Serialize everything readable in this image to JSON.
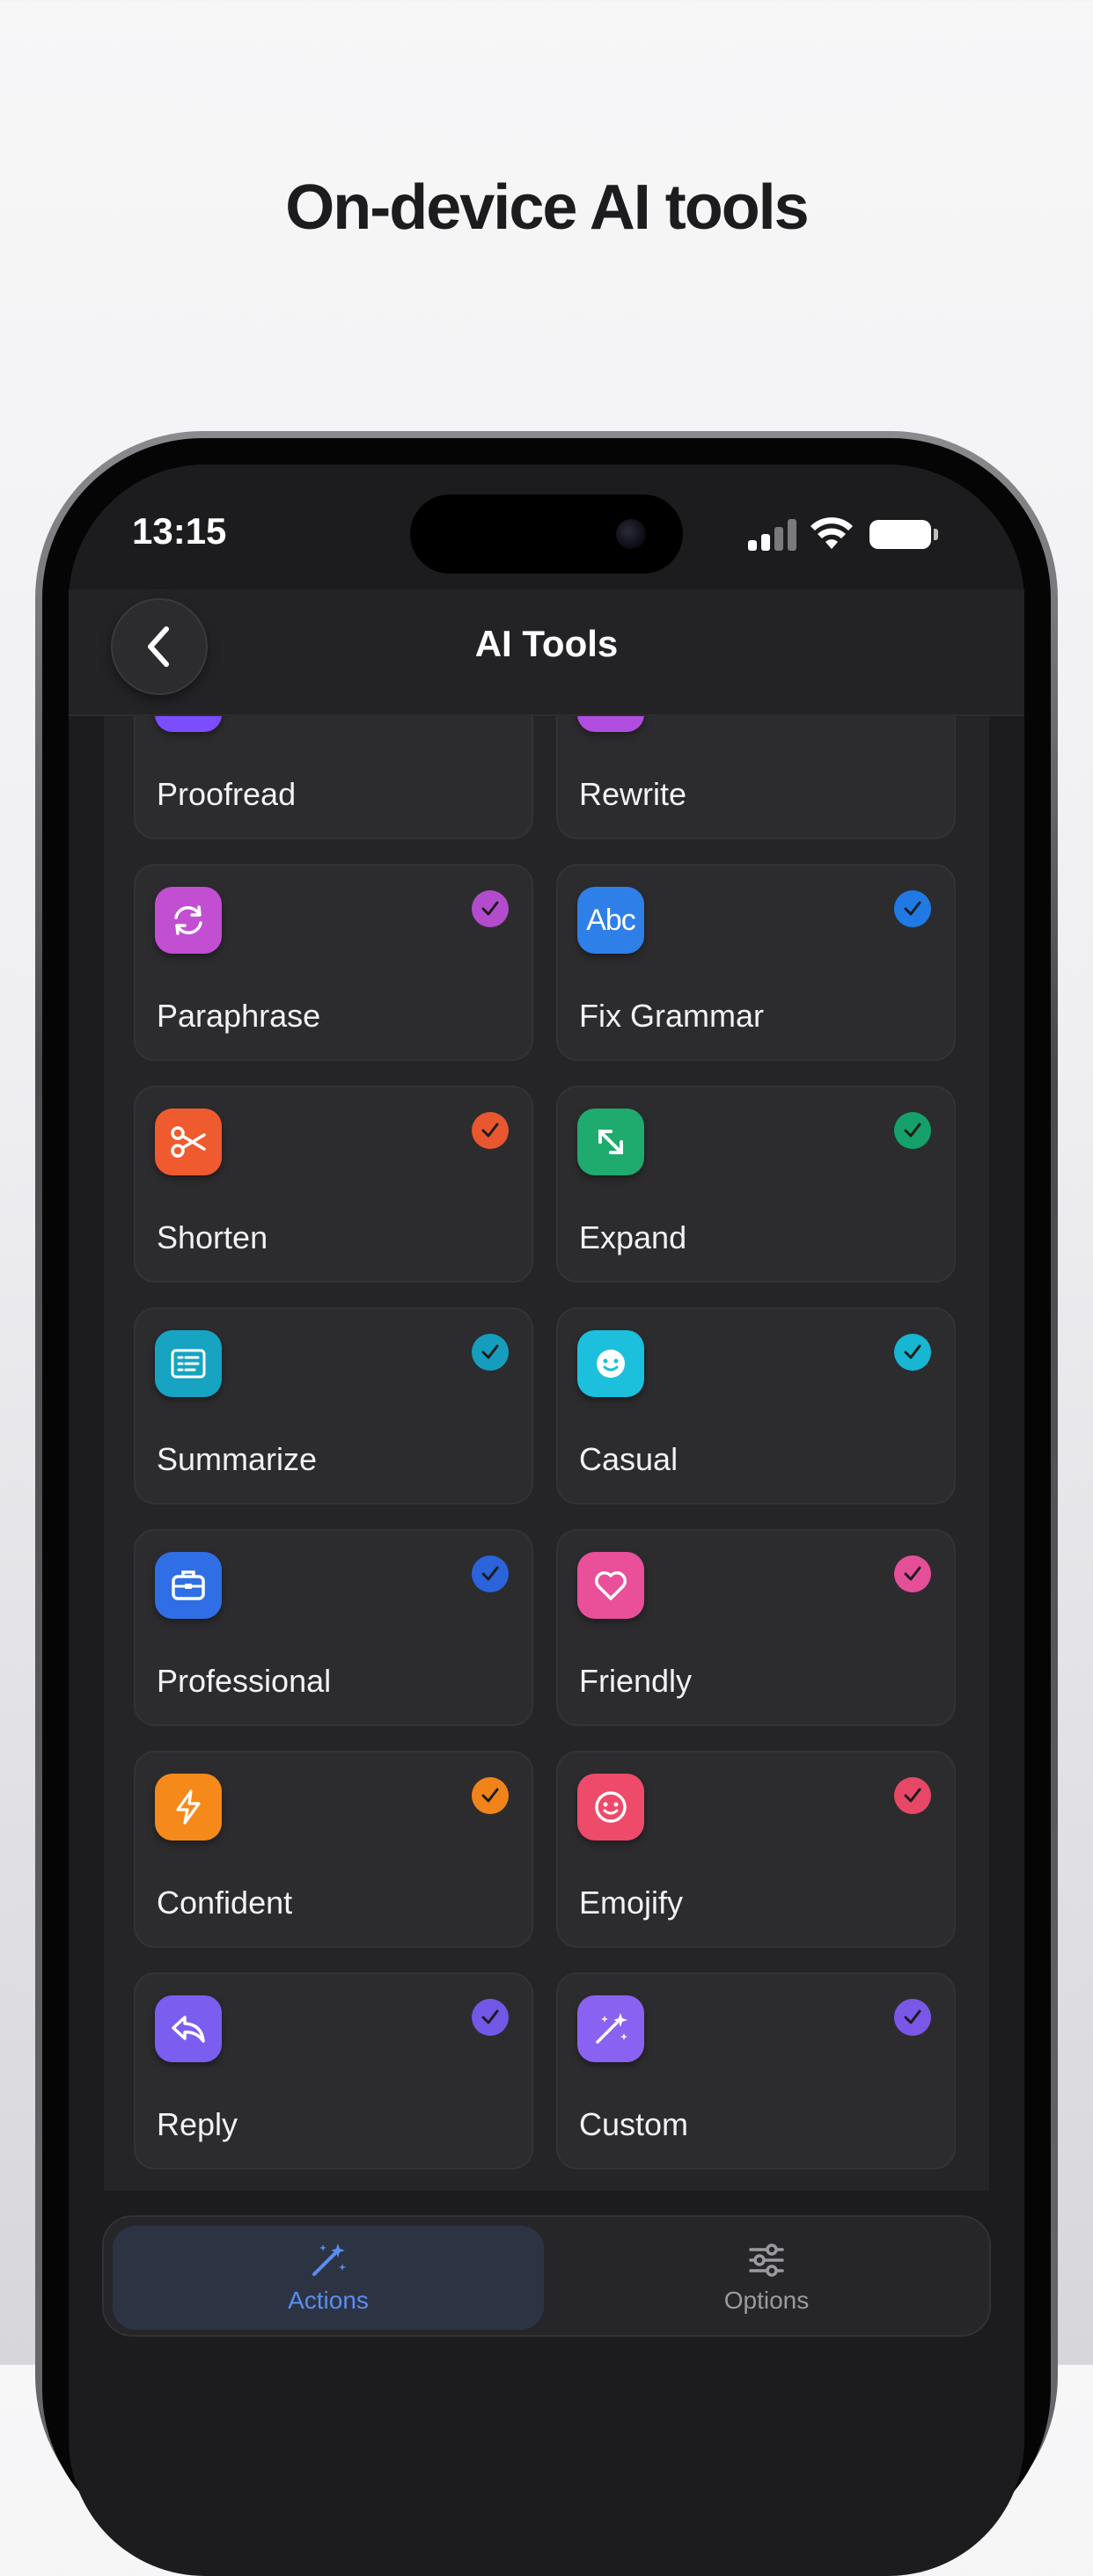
{
  "headline": "On-device AI tools",
  "status_bar": {
    "time": "13:15"
  },
  "nav": {
    "title": "AI Tools"
  },
  "tools": [
    {
      "label": "Proofread",
      "icon": "gear-badge-icon",
      "color": "#7c4dff",
      "check_color": "#6a4fd6"
    },
    {
      "label": "Rewrite",
      "icon": "pencil-circle-icon",
      "color": "#b04ddf",
      "check_color": "#a64fd0"
    },
    {
      "label": "Paraphrase",
      "icon": "cycle-arrows-icon",
      "color": "#c24fd1",
      "check_color": "#b24ccc"
    },
    {
      "label": "Fix Grammar",
      "icon": "abc-text-icon",
      "color": "#2f7fe8",
      "check_color": "#1f7ae6",
      "icon_text": "Abc"
    },
    {
      "label": "Shorten",
      "icon": "scissors-icon",
      "color": "#ef5a2f",
      "check_color": "#e8572f"
    },
    {
      "label": "Expand",
      "icon": "expand-arrows-icon",
      "color": "#1faa6e",
      "check_color": "#16a06a"
    },
    {
      "label": "Summarize",
      "icon": "document-lines-icon",
      "color": "#17a3c2",
      "check_color": "#169dbd"
    },
    {
      "label": "Casual",
      "icon": "smiley-face-icon",
      "color": "#1cbfdc",
      "check_color": "#17b6d2"
    },
    {
      "label": "Professional",
      "icon": "briefcase-icon",
      "color": "#2f6ee4",
      "check_color": "#2b63db"
    },
    {
      "label": "Friendly",
      "icon": "heart-icon",
      "color": "#ea4f9a",
      "check_color": "#e54f98"
    },
    {
      "label": "Confident",
      "icon": "lightning-icon",
      "color": "#f58a1b",
      "check_color": "#f0841a"
    },
    {
      "label": "Emojify",
      "icon": "emoji-smile-icon",
      "color": "#ee4a6a",
      "check_color": "#e64866"
    },
    {
      "label": "Reply",
      "icon": "reply-arrow-icon",
      "color": "#7b5ef0",
      "check_color": "#7357e6"
    },
    {
      "label": "Custom",
      "icon": "magic-wand-icon",
      "color": "#8a62f2",
      "check_color": "#7a57e6"
    }
  ],
  "tabs": [
    {
      "label": "Actions",
      "icon": "magic-wand-icon",
      "active": true
    },
    {
      "label": "Options",
      "icon": "sliders-icon",
      "active": false
    }
  ],
  "colors": {
    "accent_blue": "#5b8def",
    "inactive_gray": "#9a9aa0",
    "card": "#2c2c2e"
  }
}
